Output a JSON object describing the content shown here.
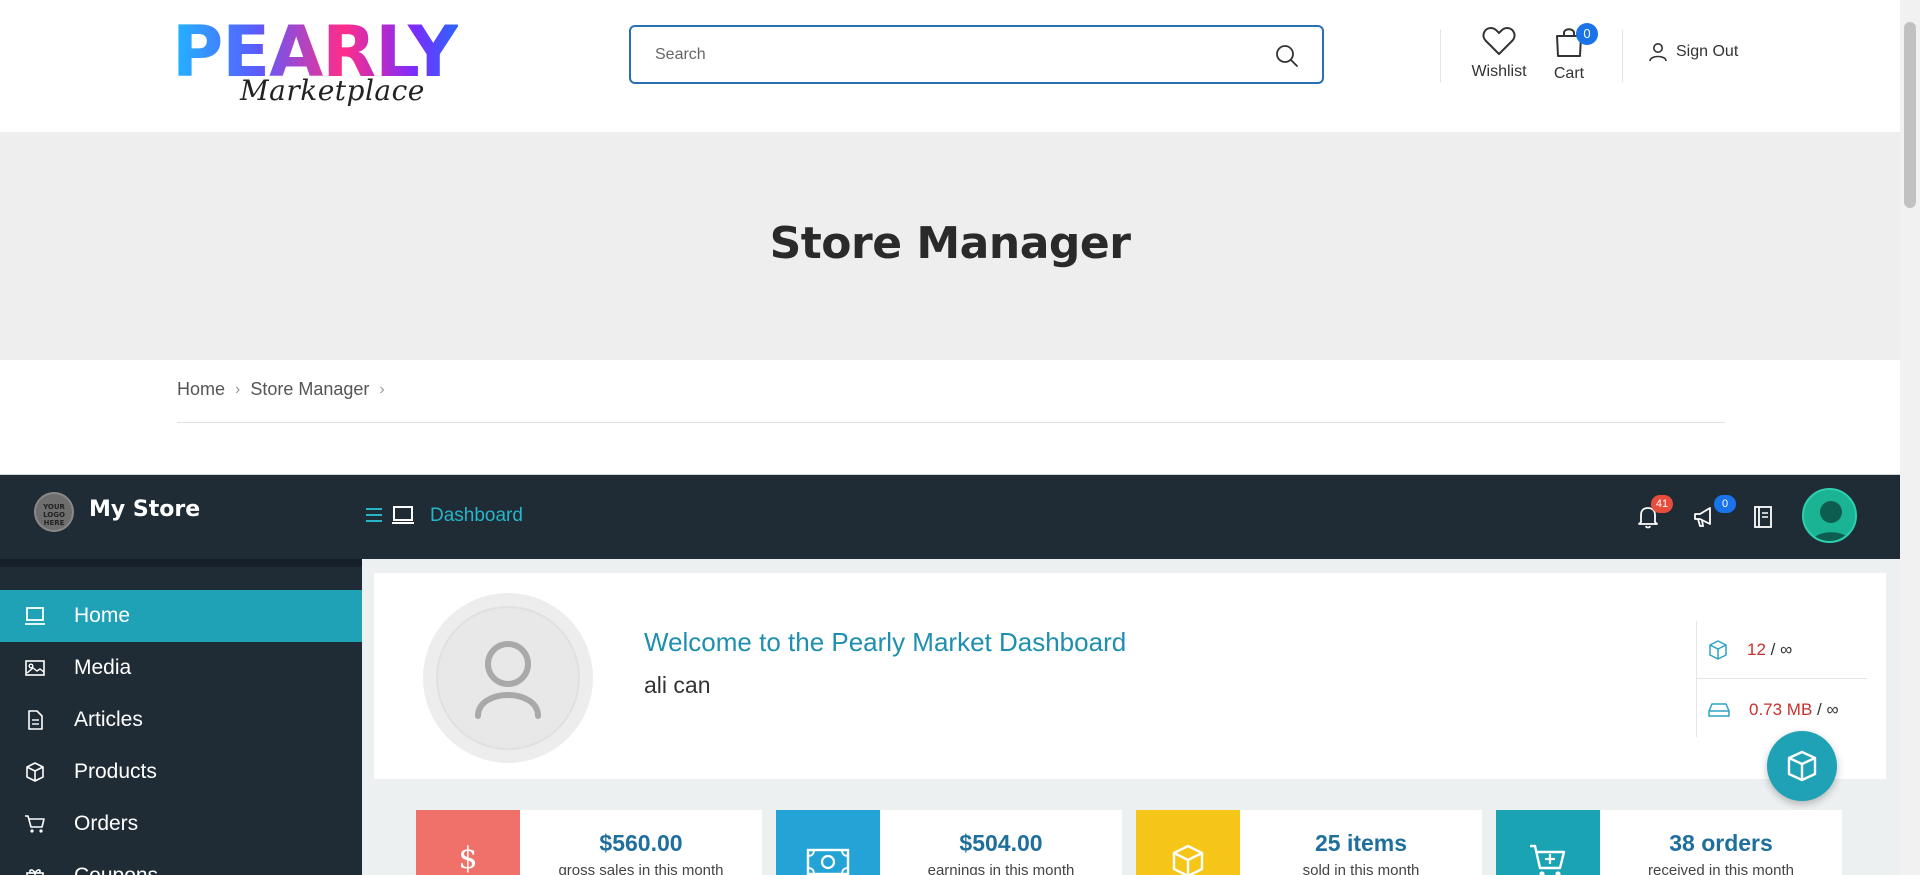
{
  "header": {
    "logo_text": "PEARLY",
    "logo_subtext": "Marketplace",
    "search_placeholder": "Search",
    "wishlist_label": "Wishlist",
    "cart_label": "Cart",
    "cart_count": "0",
    "signout_label": "Sign Out"
  },
  "banner": {
    "title": "Store Manager"
  },
  "breadcrumb": {
    "items": [
      "Home",
      "Store Manager"
    ],
    "separator": "›"
  },
  "app": {
    "store_name": "My Store",
    "store_logo_text": "YOUR LOGO HERE",
    "section_label": "Dashboard",
    "notifications_count": "41",
    "announcements_count": "0",
    "colors": {
      "dark": "#1f2c36",
      "accent": "#1fa2b5",
      "badge_red": "#e74c3c",
      "badge_blue": "#1a73e8"
    }
  },
  "sidebar": {
    "items": [
      {
        "label": "Home",
        "icon": "monitor-icon",
        "active": true
      },
      {
        "label": "Media",
        "icon": "image-icon",
        "active": false
      },
      {
        "label": "Articles",
        "icon": "document-icon",
        "active": false
      },
      {
        "label": "Products",
        "icon": "box-icon",
        "active": false
      },
      {
        "label": "Orders",
        "icon": "cart-icon",
        "active": false
      },
      {
        "label": "Coupons",
        "icon": "gift-icon",
        "active": false
      }
    ]
  },
  "welcome": {
    "title": "Welcome to the Pearly Market Dashboard",
    "user": "ali can",
    "products_used": "12",
    "products_limit": "/ ∞",
    "space_used": "0.73 MB",
    "space_limit": "/ ∞"
  },
  "stats": [
    {
      "amount": "$560.00",
      "desc": "gross sales in this month",
      "color": "#f0706a",
      "icon": "dollar-icon"
    },
    {
      "amount": "$504.00",
      "desc": "earnings in this month",
      "color": "#23a3d6",
      "icon": "banknote-icon"
    },
    {
      "amount": "25 items",
      "desc": "sold in this month",
      "color": "#f5c518",
      "icon": "box-icon"
    },
    {
      "amount": "38 orders",
      "desc": "received in this month",
      "color": "#1aa3b3",
      "icon": "cart-add-icon"
    }
  ]
}
